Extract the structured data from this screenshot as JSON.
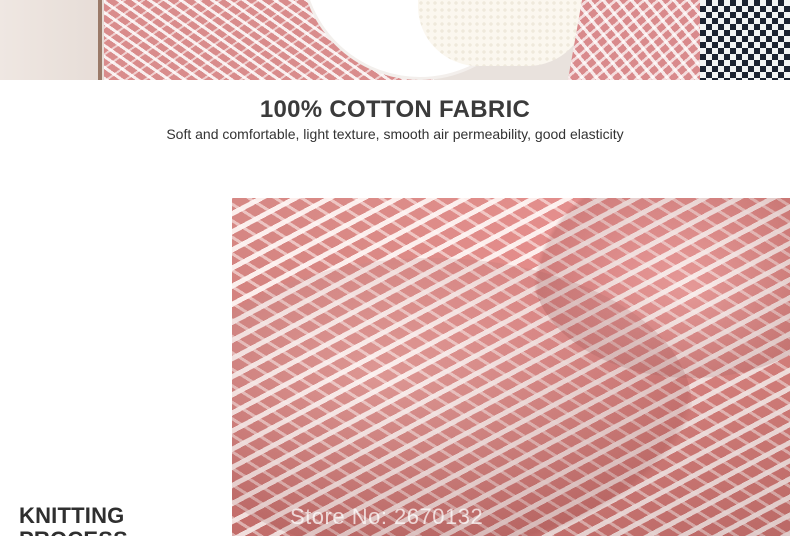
{
  "hero": {
    "title": "100% COTTON FABRIC",
    "subtitle": "Soft and comfortable, light texture, smooth air permeability, good elasticity"
  },
  "section": {
    "title_line1": "KNITTING",
    "title_line2": "PROCESS"
  },
  "watermark": "Store No: 2670132",
  "colors": {
    "blanket_pink": "#d98a8c",
    "heading_text": "#3b3b3b",
    "background": "#ffffff"
  }
}
